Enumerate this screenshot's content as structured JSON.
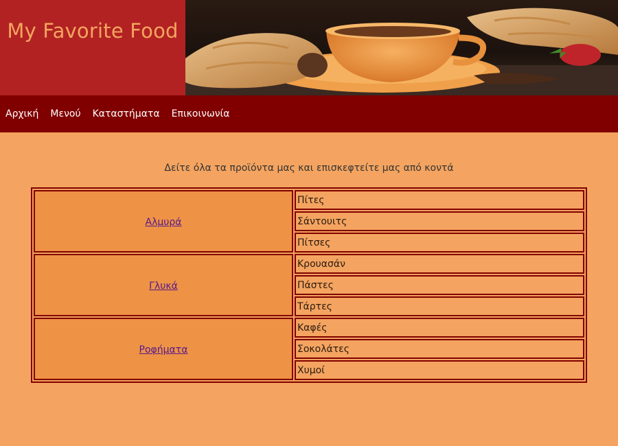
{
  "header": {
    "title": "My Favorite Food"
  },
  "nav": {
    "items": [
      "Αρχική",
      "Μενού",
      "Καταστήματα",
      "Επικοινωνία"
    ]
  },
  "intro": "Δείτε όλα τα προϊόντα μας και επισκεφτείτε μας από κοντά",
  "categories": [
    {
      "name": "Αλμυρά",
      "items": [
        "Πίτες",
        "Σάντουιτς",
        "Πίτσες"
      ]
    },
    {
      "name": "Γλυκά",
      "items": [
        "Κρουασάν",
        "Πάστες",
        "Τάρτες"
      ]
    },
    {
      "name": "Ροφήματα",
      "items": [
        "Καφές",
        "Σοκολάτες",
        "Χυμοί"
      ]
    }
  ],
  "colors": {
    "page_bg": "#f4a460",
    "title_bg": "#b22222",
    "nav_bg": "#800000",
    "table_border": "#800000",
    "category_bg": "#ee9246",
    "link": "#551a8b"
  }
}
